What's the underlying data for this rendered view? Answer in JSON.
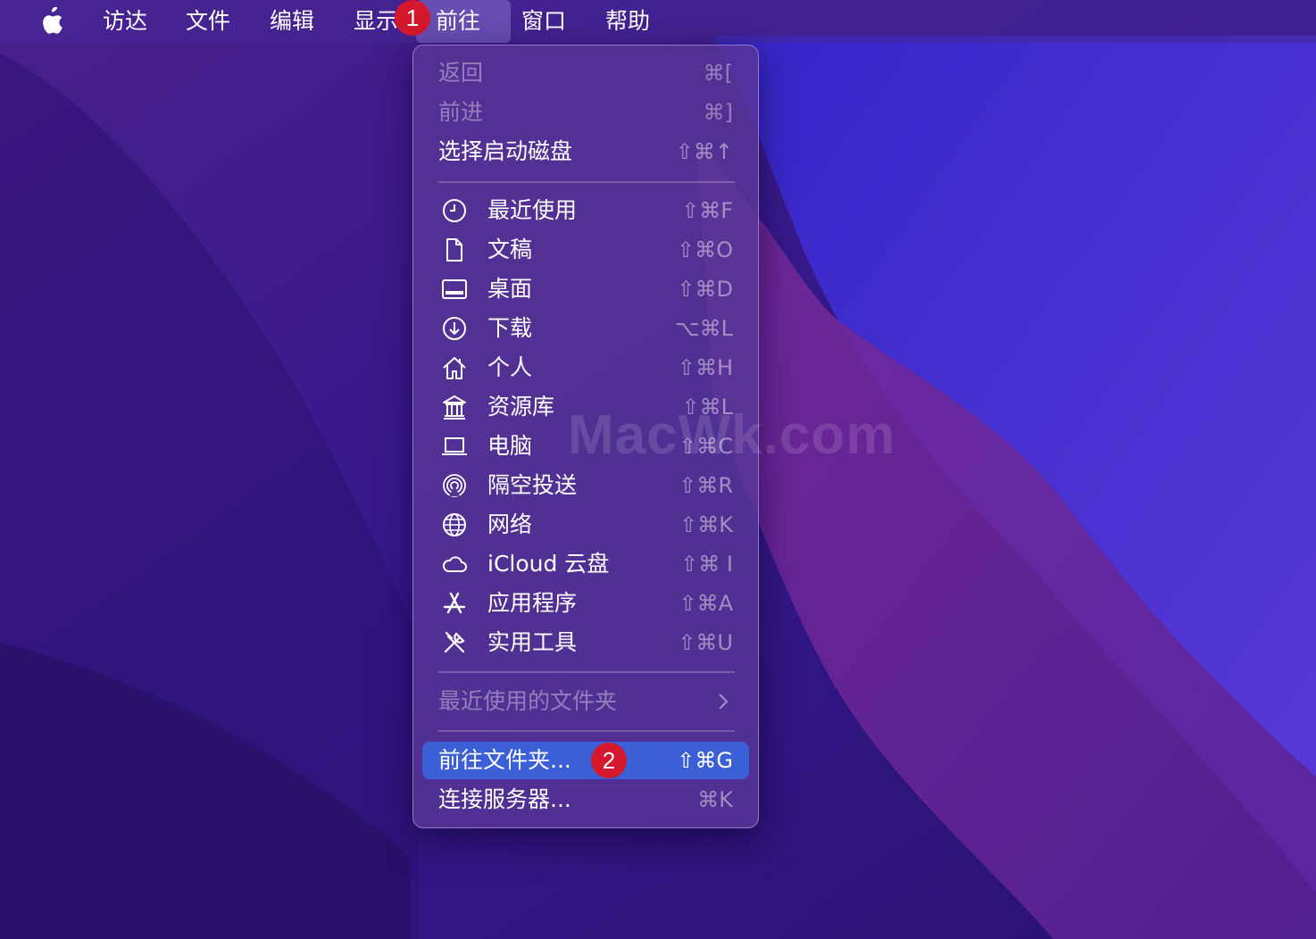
{
  "menubar": {
    "items": [
      {
        "label": "访达"
      },
      {
        "label": "文件"
      },
      {
        "label": "编辑"
      },
      {
        "label": "显示"
      },
      {
        "label": "前往",
        "active": true
      },
      {
        "label": "窗口"
      },
      {
        "label": "帮助"
      }
    ]
  },
  "annotations": {
    "step1": "1",
    "step2": "2",
    "badge_color": "#d6182d"
  },
  "go_menu": {
    "items": [
      {
        "label": "返回",
        "shortcut": "⌘[",
        "disabled": true
      },
      {
        "label": "前进",
        "shortcut": "⌘]",
        "disabled": true
      },
      {
        "label": "选择启动磁盘",
        "shortcut": "⇧⌘↑"
      },
      {
        "label": "最近使用",
        "shortcut": "⇧⌘F",
        "icon": "clock-icon"
      },
      {
        "label": "文稿",
        "shortcut": "⇧⌘O",
        "icon": "document-icon"
      },
      {
        "label": "桌面",
        "shortcut": "⇧⌘D",
        "icon": "desktop-icon"
      },
      {
        "label": "下载",
        "shortcut": "⌥⌘L",
        "icon": "download-icon"
      },
      {
        "label": "个人",
        "shortcut": "⇧⌘H",
        "icon": "home-icon"
      },
      {
        "label": "资源库",
        "shortcut": "⇧⌘L",
        "icon": "library-icon"
      },
      {
        "label": "电脑",
        "shortcut": "⇧⌘C",
        "icon": "laptop-icon"
      },
      {
        "label": "隔空投送",
        "shortcut": "⇧⌘R",
        "icon": "airdrop-icon"
      },
      {
        "label": "网络",
        "shortcut": "⇧⌘K",
        "icon": "globe-icon"
      },
      {
        "label": "iCloud 云盘",
        "shortcut": "⇧⌘ I",
        "icon": "cloud-icon"
      },
      {
        "label": "应用程序",
        "shortcut": "⇧⌘A",
        "icon": "app-store-icon"
      },
      {
        "label": "实用工具",
        "shortcut": "⇧⌘U",
        "icon": "tools-icon"
      },
      {
        "label": "最近使用的文件夹",
        "submenu": true,
        "disabled": true
      },
      {
        "label": "前往文件夹...",
        "shortcut": "⇧⌘G",
        "highlighted": true
      },
      {
        "label": "连接服务器...",
        "shortcut": "⌘K"
      }
    ]
  },
  "watermark": {
    "text": "MacWk.com"
  },
  "colors": {
    "highlight": "#3a5fd6",
    "menu_bg": "#58368f"
  }
}
